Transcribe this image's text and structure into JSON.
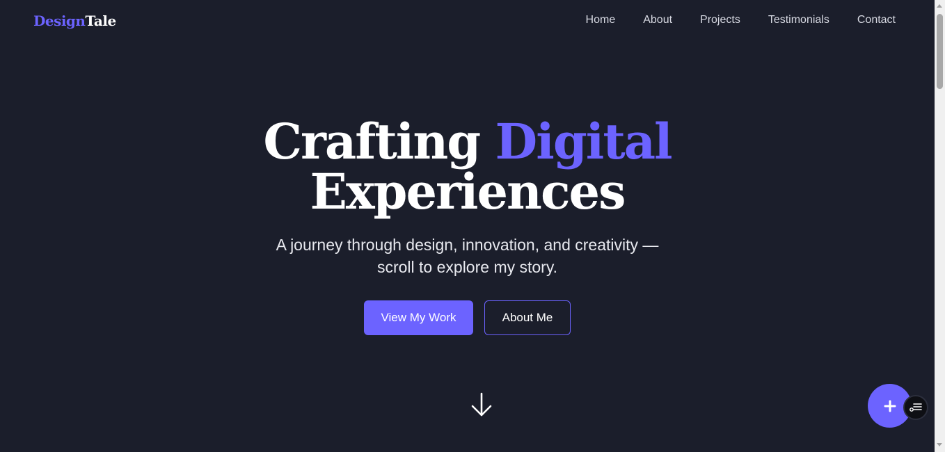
{
  "header": {
    "logo_part1": "Design",
    "logo_part2": "Tale",
    "nav": [
      "Home",
      "About",
      "Projects",
      "Testimonials",
      "Contact"
    ]
  },
  "hero": {
    "title_word1": "Crafting",
    "title_word2": "Digital",
    "title_line2": "Experiences",
    "subtitle_line1": "A journey through design, innovation, and creativity —",
    "subtitle_line2": "scroll to explore my story.",
    "primary_button": "View My Work",
    "secondary_button": "About Me"
  },
  "icons": {
    "scroll": "arrow-down-icon",
    "fab": "plus-icon",
    "fab_secondary": "toggle-list-icon"
  },
  "colors": {
    "background": "#1b1e2b",
    "accent": "#6c63ff",
    "text": "#ffffff"
  }
}
